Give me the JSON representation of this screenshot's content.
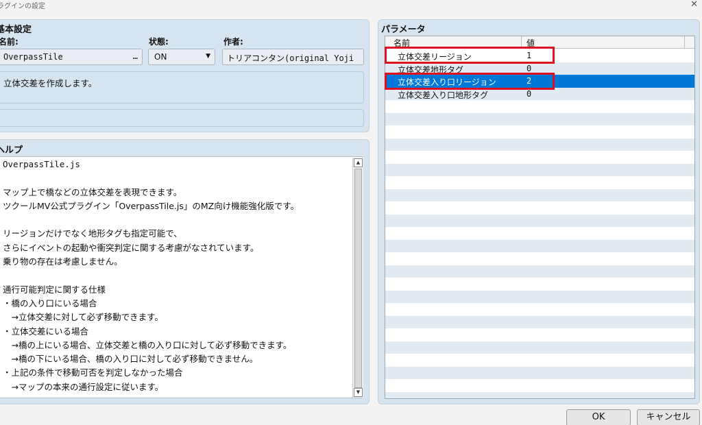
{
  "window": {
    "title": "プラグインの設定",
    "close_glyph": "✕"
  },
  "basic": {
    "title": "基本設定",
    "name_label": "名前:",
    "name_value": "OverpassTile",
    "name_button": "…",
    "state_label": "状態:",
    "state_value": "ON",
    "state_arrow": "▼",
    "author_label": "作者:",
    "author_value": "トリアコンタン(original Yoji",
    "description": "立体交差を作成します。"
  },
  "help": {
    "title": "ヘルプ",
    "lines": [
      "OverpassTile.js",
      "",
      "マップ上で橋などの立体交差を表現できます。",
      "ツクールMV公式プラグイン「OverpassTile.js」のMZ向け機能強化版です。",
      "",
      "リージョンだけでなく地形タグも指定可能で、",
      "さらにイベントの起動や衝突判定に関する考慮がなされています。",
      "乗り物の存在は考慮しません。",
      "",
      "通行可能判定に関する仕様",
      "・橋の入り口にいる場合",
      "　→立体交差に対して必ず移動できます。",
      "・立体交差にいる場合",
      "　→橋の上にいる場合、立体交差と橋の入り口に対して必ず移動できます。",
      "　→橋の下にいる場合、橋の入り口に対して必ず移動できません。",
      "・上記の条件で移動可否を判定しなかった場合",
      "　→マップの本来の通行設定に従います。"
    ],
    "scroll_up": "▲",
    "scroll_down": "▼"
  },
  "params": {
    "title": "パラメータ",
    "col_name": "名前",
    "col_value": "値",
    "rows": [
      {
        "name": "立体交差リージョン",
        "value": "1"
      },
      {
        "name": "立体交差地形タグ",
        "value": "0"
      },
      {
        "name": "立体交差入り口リージョン",
        "value": "2"
      },
      {
        "name": "立体交差入り口地形タグ",
        "value": "0"
      }
    ],
    "selected_index": 2
  },
  "buttons": {
    "ok": "OK",
    "cancel": "キャンセル"
  },
  "colors": {
    "selection": "#0078d7",
    "highlight": "#e01020",
    "panel": "#d6e4f0"
  }
}
